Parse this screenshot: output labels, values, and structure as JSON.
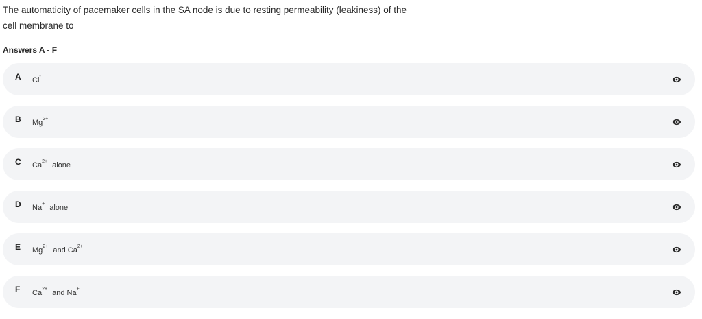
{
  "question": {
    "line1": "The automaticity of pacemaker cells in the SA node is due to resting permeability (leakiness) of the",
    "line2": "cell membrane to"
  },
  "answers_heading": "Answers A - F",
  "options": [
    {
      "letter": "A",
      "parts": [
        {
          "base": "Cl",
          "sup": "-"
        }
      ],
      "tail": "",
      "icon": "eye-icon"
    },
    {
      "letter": "B",
      "parts": [
        {
          "base": "Mg",
          "sup": "2+"
        }
      ],
      "tail": "",
      "icon": "eye-icon"
    },
    {
      "letter": "C",
      "parts": [
        {
          "base": "Ca",
          "sup": "2+"
        }
      ],
      "tail": "alone",
      "icon": "eye-icon"
    },
    {
      "letter": "D",
      "parts": [
        {
          "base": "Na",
          "sup": "+"
        }
      ],
      "tail": "alone",
      "icon": "eye-icon"
    },
    {
      "letter": "E",
      "parts": [
        {
          "base": "Mg",
          "sup": "2+"
        },
        {
          "join": "and"
        },
        {
          "base": "Ca",
          "sup": "2+"
        }
      ],
      "tail": "",
      "icon": "eye-icon"
    },
    {
      "letter": "F",
      "parts": [
        {
          "base": "Ca",
          "sup": "2+"
        },
        {
          "join": "and"
        },
        {
          "base": "Na",
          "sup": "+"
        }
      ],
      "tail": "",
      "icon": "eye-icon"
    }
  ],
  "colors": {
    "option_background": "#f3f4f6",
    "text": "#222222",
    "icon": "#2b2b2b"
  }
}
